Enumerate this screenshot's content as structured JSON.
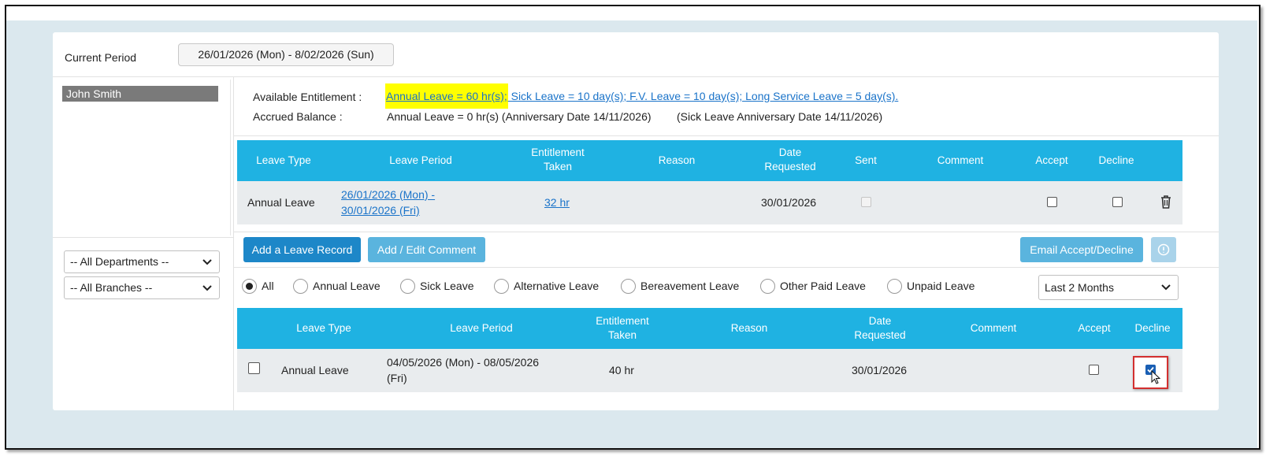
{
  "period": {
    "label": "Current Period",
    "value": "26/01/2026 (Mon) - 8/02/2026 (Sun)"
  },
  "employees": [
    "John Smith"
  ],
  "filters": {
    "department": "-- All Departments --",
    "branch": "-- All Branches --",
    "range": "Last 2 Months"
  },
  "entitlement": {
    "available_label": "Available Entitlement :",
    "annual": "Annual Leave = 60 hr(s);",
    "others": " Sick Leave = 10 day(s); F.V. Leave = 10 day(s); Long Service Leave = 5 day(s).",
    "accrued_label": "Accrued Balance :",
    "accrued_value": "Annual Leave = 0 hr(s) (Anniversary Date 14/11/2026)",
    "sick_anniversary": "(Sick Leave Anniversary Date 14/11/2026)"
  },
  "table1": {
    "headers": {
      "leave_type": "Leave Type",
      "leave_period": "Leave Period",
      "entitlement1": "Entitlement",
      "entitlement2": "Taken",
      "reason": "Reason",
      "date1": "Date",
      "date2": "Requested",
      "sent": "Sent",
      "comment": "Comment",
      "accept": "Accept",
      "decline": "Decline"
    },
    "row": {
      "leave_type": "Annual Leave",
      "period1": "26/01/2026 (Mon) -",
      "period2": "30/01/2026 (Fri)",
      "taken": "32 hr",
      "date_requested": "30/01/2026"
    }
  },
  "buttons": {
    "add_record": "Add a Leave Record",
    "edit_comment": "Add / Edit Comment",
    "email": "Email Accept/Decline"
  },
  "radios": [
    "All",
    "Annual Leave",
    "Sick Leave",
    "Alternative Leave",
    "Bereavement Leave",
    "Other Paid Leave",
    "Unpaid Leave"
  ],
  "table2": {
    "headers": {
      "leave_type": "Leave Type",
      "leave_period": "Leave Period",
      "entitlement1": "Entitlement",
      "entitlement2": "Taken",
      "reason": "Reason",
      "date1": "Date",
      "date2": "Requested",
      "comment": "Comment",
      "accept": "Accept",
      "decline": "Decline"
    },
    "row": {
      "leave_type": "Annual Leave",
      "period1": "04/05/2026 (Mon) - 08/05/2026",
      "period2": "(Fri)",
      "taken": "40 hr",
      "date_requested": "30/01/2026",
      "decline_checked": true
    }
  },
  "colors": {
    "header_blue": "#1fb2e2",
    "button_blue": "#1d87c8",
    "highlight": "#ffff00",
    "callout": "#d32f2f"
  }
}
